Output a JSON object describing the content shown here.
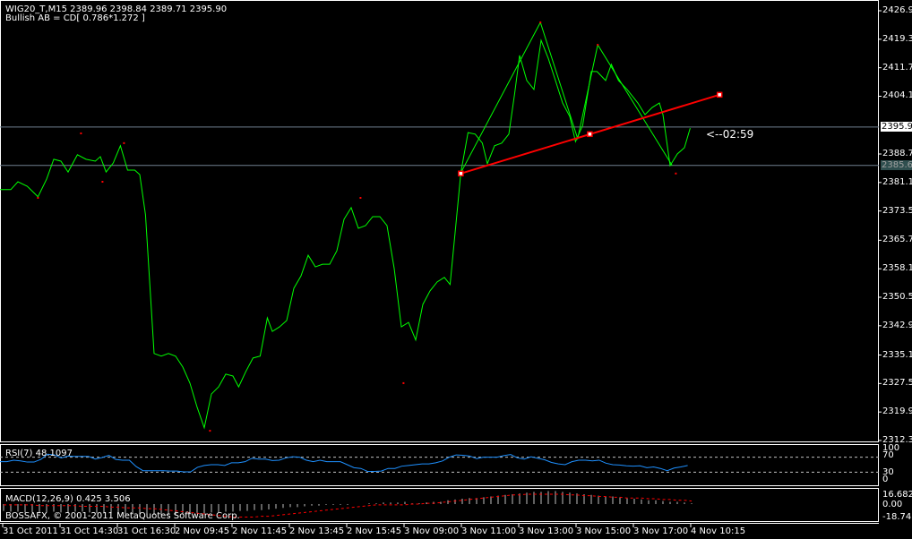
{
  "header": {
    "symbol_line": "WIG20_T,M15  2389.96 2398.84 2389.71 2395.90",
    "pattern_line": "Bullish AB = CD[ 0.786*1.272 ]"
  },
  "colors": {
    "price": "#00ff00",
    "fractal": "#ff0000",
    "trend": "#ff0000",
    "rsi": "#1e90ff",
    "macd_hist": "#c0c0c0",
    "macd_signal": "#ff0000",
    "grid_h": "#708090"
  },
  "price_axis": {
    "min": 2312.3,
    "max": 2426.9,
    "ticks": [
      "2426.90",
      "2419.30",
      "2411.70",
      "2404.10",
      "2388.70",
      "2381.10",
      "2373.50",
      "2365.70",
      "2358.10",
      "2350.50",
      "2342.90",
      "2335.10",
      "2327.50",
      "2319.90",
      "2312.30"
    ],
    "bid_label": "2395.90",
    "bid": 2395.9,
    "line2_label": "2385.65",
    "line2": 2385.65
  },
  "countdown": "<--02:59",
  "chart_data": {
    "type": "line",
    "price_series": [
      [
        0,
        2379.2
      ],
      [
        1.5,
        2379.2
      ],
      [
        2.5,
        2381.3
      ],
      [
        3.8,
        2380.1
      ],
      [
        5.3,
        2377.3
      ],
      [
        6.5,
        2382
      ],
      [
        7.5,
        2387.3
      ],
      [
        8.5,
        2386.8
      ],
      [
        9.5,
        2383.9
      ],
      [
        10.8,
        2388.5
      ],
      [
        12,
        2387.3
      ],
      [
        13.3,
        2386.8
      ],
      [
        14,
        2388
      ],
      [
        14.8,
        2383.9
      ],
      [
        15.8,
        2386.3
      ],
      [
        16.8,
        2390.9
      ],
      [
        17.8,
        2384.4
      ],
      [
        18.8,
        2384.4
      ],
      [
        19.5,
        2383.2
      ],
      [
        20.3,
        2372.5
      ],
      [
        21,
        2351
      ],
      [
        21.5,
        2335.5
      ],
      [
        22.5,
        2334.8
      ],
      [
        23.5,
        2335.5
      ],
      [
        24.5,
        2334.8
      ],
      [
        25.5,
        2331.9
      ],
      [
        26.5,
        2327.6
      ],
      [
        27.5,
        2321.2
      ],
      [
        28.5,
        2315.7
      ],
      [
        29.5,
        2324.7
      ],
      [
        30.5,
        2326.6
      ],
      [
        31.5,
        2330
      ],
      [
        32.5,
        2329.5
      ],
      [
        33.3,
        2326.6
      ],
      [
        34.3,
        2330.7
      ],
      [
        35.3,
        2334.3
      ],
      [
        36.3,
        2334.8
      ],
      [
        37.3,
        2345
      ],
      [
        38,
        2341.4
      ],
      [
        39,
        2342.6
      ],
      [
        40,
        2344.3
      ],
      [
        41,
        2352.9
      ],
      [
        42,
        2356.2
      ],
      [
        43,
        2361.7
      ],
      [
        44,
        2358.6
      ],
      [
        45,
        2359.3
      ],
      [
        46,
        2359.3
      ],
      [
        47,
        2362.9
      ],
      [
        48,
        2371.3
      ],
      [
        49,
        2374.4
      ],
      [
        50,
        2368.9
      ],
      [
        51,
        2369.6
      ],
      [
        52,
        2372
      ],
      [
        53,
        2372
      ],
      [
        54,
        2369.6
      ],
      [
        55,
        2358.2
      ],
      [
        56,
        2342.6
      ],
      [
        57,
        2343.8
      ],
      [
        58,
        2339.1
      ],
      [
        59,
        2348.6
      ],
      [
        60,
        2352.2
      ],
      [
        61,
        2354.6
      ],
      [
        62,
        2355.8
      ],
      [
        62.8,
        2353.9
      ],
      [
        63.5,
        2367.7
      ],
      [
        64.3,
        2383.7
      ],
      [
        65.3,
        2394.4
      ],
      [
        66.3,
        2394
      ],
      [
        67.3,
        2391.6
      ],
      [
        68,
        2386.1
      ],
      [
        69,
        2390.9
      ],
      [
        70,
        2391.6
      ],
      [
        71,
        2394
      ],
      [
        71.8,
        2404.7
      ],
      [
        72.5,
        2415
      ],
      [
        73.5,
        2408.3
      ],
      [
        74.5,
        2405.9
      ],
      [
        75.5,
        2419
      ],
      [
        76.5,
        2414.2
      ],
      [
        77.5,
        2408.3
      ],
      [
        78.5,
        2402.3
      ],
      [
        79.5,
        2398.7
      ],
      [
        80.3,
        2392
      ],
      [
        81.3,
        2396.3
      ],
      [
        82.5,
        2410.7
      ],
      [
        83.3,
        2410.7
      ],
      [
        84.5,
        2408.3
      ],
      [
        85.3,
        2412.6
      ],
      [
        86.3,
        2408.3
      ],
      [
        87.5,
        2405.9
      ],
      [
        89,
        2402.3
      ],
      [
        90,
        2399.2
      ],
      [
        91,
        2401.1
      ],
      [
        92,
        2402.3
      ],
      [
        92.5,
        2399.2
      ],
      [
        93.5,
        2385.6
      ],
      [
        94.5,
        2388.7
      ],
      [
        95.5,
        2390.4
      ],
      [
        96.3,
        2395.6
      ]
    ],
    "zigzag": [
      [
        64.3,
        2383.7
      ],
      [
        75.4,
        2423.8
      ],
      [
        80.6,
        2392.8
      ],
      [
        83.4,
        2417.8
      ],
      [
        93.8,
        2385.6
      ]
    ],
    "fractals": [
      [
        5.3,
        2377
      ],
      [
        11.3,
        2394.2
      ],
      [
        14.3,
        2381.3
      ],
      [
        17.3,
        2391.6
      ],
      [
        29.3,
        2314.9
      ],
      [
        50.3,
        2377
      ],
      [
        56.3,
        2327.6
      ],
      [
        75.4,
        2423.8
      ],
      [
        83.4,
        2417.8
      ],
      [
        94.3,
        2383.5
      ]
    ],
    "trendline": [
      [
        64.3,
        2383.5
      ],
      [
        82.3,
        2394
      ],
      [
        100.4,
        2404.5
      ]
    ],
    "rsi": {
      "label": "RSI(7) 48.1097",
      "levels": [
        "100",
        "70",
        "30",
        "0"
      ],
      "values": [
        58,
        58,
        62,
        60,
        57,
        57,
        64,
        78,
        76,
        68,
        73,
        72,
        72,
        72,
        65,
        69,
        75,
        64,
        62,
        62,
        45,
        34,
        34,
        34,
        34,
        33,
        33,
        31,
        31,
        43,
        48,
        50,
        50,
        48,
        55,
        55,
        58,
        67,
        65,
        65,
        61,
        62,
        68,
        71,
        70,
        62,
        58,
        62,
        58,
        58,
        58,
        50,
        42,
        40,
        32,
        32,
        33,
        40,
        40,
        46,
        48,
        50,
        52,
        52,
        55,
        60,
        70,
        76,
        75,
        73,
        66,
        70,
        70,
        70,
        74,
        77,
        68,
        65,
        71,
        67,
        63,
        56,
        52,
        50,
        58,
        62,
        62,
        60,
        62,
        54,
        50,
        49,
        47,
        46,
        47,
        42,
        44,
        40,
        34,
        41,
        44,
        48
      ]
    },
    "macd": {
      "label": "MACD(12,26,9) 0.425 3.506",
      "ticks": [
        "16.682",
        "0.00",
        "-18.748"
      ],
      "hist": [
        -9,
        -10,
        -10,
        -11,
        -11,
        -12,
        -11,
        -10,
        -11,
        -11,
        -10,
        -10,
        -11,
        -12,
        -12,
        -12,
        -12,
        -13,
        -13,
        -13,
        -14,
        -14,
        -14,
        -14,
        -14,
        -13,
        -13,
        -12,
        -12,
        -11,
        -11,
        -10,
        -10,
        -9,
        -9,
        -8,
        -8,
        -7,
        -6,
        -5,
        -4,
        -4,
        -3,
        -2,
        -2,
        -1,
        -1,
        -1,
        -1,
        0,
        0,
        1,
        1,
        2,
        2,
        2,
        3,
        1,
        1,
        2,
        3,
        3,
        5,
        6,
        7,
        8,
        8,
        9,
        10,
        11,
        12,
        13,
        14,
        15,
        16,
        16,
        17,
        17,
        16,
        15,
        14,
        13,
        12,
        11,
        10,
        10,
        9,
        8,
        7,
        6,
        5,
        5,
        4,
        3,
        3,
        2,
        1
      ],
      "signal": [
        -1,
        -1,
        -1,
        -1,
        -1,
        -2,
        -2,
        -2,
        -2,
        -2,
        -2,
        -3,
        -3,
        -3,
        -3,
        -4,
        -4,
        -5,
        -5,
        -5,
        -6,
        -6,
        -7,
        -8,
        -9,
        -10,
        -11,
        -12,
        -13,
        -14,
        -15,
        -16,
        -17,
        -17,
        -17,
        -17,
        -16,
        -16,
        -15,
        -14,
        -13,
        -12,
        -11,
        -10,
        -9,
        -8,
        -7,
        -6,
        -5,
        -4,
        -3,
        -2,
        -1,
        -1,
        -1,
        -1,
        -1,
        0,
        0,
        1,
        1,
        2,
        3,
        4,
        5,
        6,
        7,
        8,
        9,
        10,
        11,
        12,
        12,
        13,
        13,
        13,
        13,
        13,
        13,
        12,
        12,
        11,
        11,
        10,
        10,
        9,
        9,
        8,
        8,
        8,
        7,
        7,
        6,
        6,
        5,
        5,
        4
      ]
    },
    "xlabels": [
      "31 Oct 2011",
      "31 Oct 14:30",
      "31 Oct 16:30",
      "2 Nov 09:45",
      "2 Nov 11:45",
      "2 Nov 13:45",
      "2 Nov 15:45",
      "3 Nov 09:00",
      "3 Nov 11:00",
      "3 Nov 13:00",
      "3 Nov 15:00",
      "3 Nov 17:00",
      "4 Nov 10:15"
    ]
  },
  "copyright": "BOSSAFX, © 2001-2011 MetaQuotes Software Corp."
}
